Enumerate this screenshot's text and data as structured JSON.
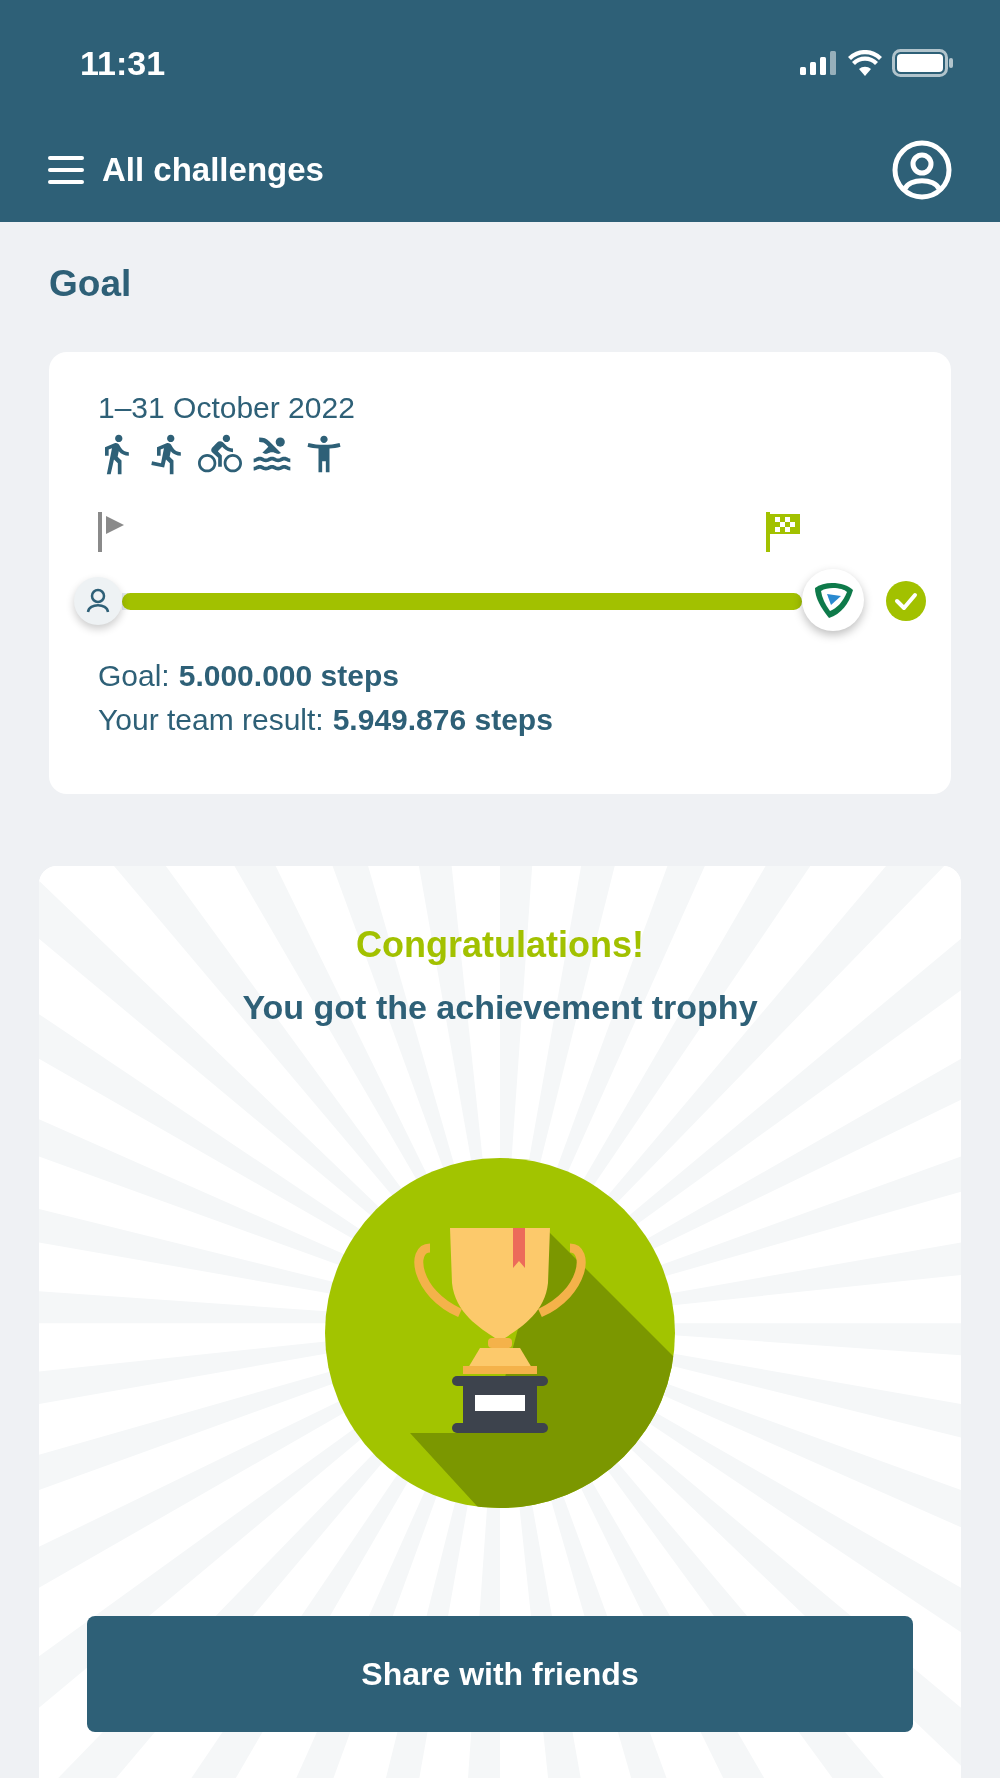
{
  "status_bar": {
    "time": "11:31"
  },
  "header": {
    "title": "All challenges"
  },
  "section_title": "Goal",
  "goal_card": {
    "date_range": "1–31 October 2022",
    "activities": [
      {
        "kind": "walk"
      },
      {
        "kind": "run"
      },
      {
        "kind": "bike"
      },
      {
        "kind": "swim"
      },
      {
        "kind": "fitness"
      }
    ],
    "progress": {
      "level": 1,
      "completed": true
    },
    "goal_label": "Goal:",
    "goal_value": "5.000.000 steps",
    "result_label": "Your team result:",
    "result_value": "5.949.876 steps"
  },
  "trophy_card": {
    "heading": "Congratulations!",
    "subtitle": "You got the achievement trophy",
    "button": "Share with friends"
  }
}
